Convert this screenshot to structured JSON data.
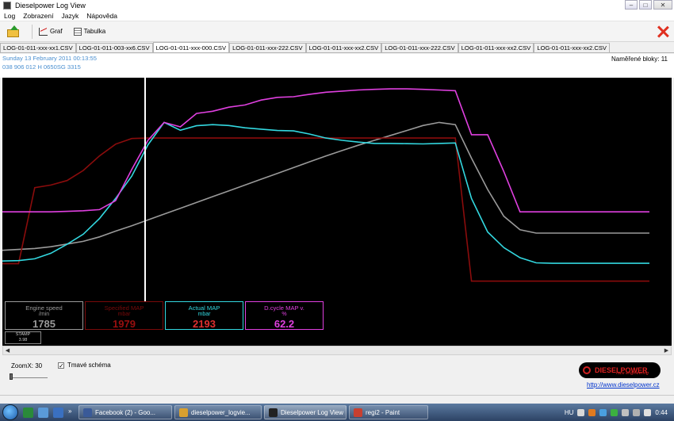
{
  "window": {
    "title": "Dieselpower Log View",
    "buttons": [
      "–",
      "□",
      "✕"
    ]
  },
  "menu": [
    "Log",
    "Zobrazení",
    "Jazyk",
    "Nápověda"
  ],
  "toolbar": {
    "graph_label": "Graf",
    "table_label": "Tabulka"
  },
  "tabs": [
    {
      "label": "LOG-01-011-xxx-xx1.CSV",
      "active": false
    },
    {
      "label": "LOG-01-011-003-xx6.CSV",
      "active": false
    },
    {
      "label": "LOG-01-011-xxx-000.CSV",
      "active": true
    },
    {
      "label": "LOG-01-011-xxx-222.CSV",
      "active": false
    },
    {
      "label": "LOG-01-011-xxx-xx2.CSV",
      "active": false
    },
    {
      "label": "LOG-01-011-xxx-222.CSV",
      "active": false
    },
    {
      "label": "LOG-01-011-xxx-xx2.CSV",
      "active": false
    },
    {
      "label": "LOG-01-011-xxx-xx2.CSV",
      "active": false
    }
  ],
  "info": {
    "date": "Sunday 13 February 2011 00:13:55",
    "ecu": "038 906 012 H  0650SG  3315",
    "blocks": "Naměřené bloky: 11"
  },
  "value_boxes": [
    {
      "name": "Engine speed",
      "unit": "/min",
      "value": "1785",
      "color": "#9a9a9a",
      "value_color": "#9a9a9a"
    },
    {
      "name": "Specified MAP",
      "unit": "mbar",
      "value": "1979",
      "color": "#7a0a0a",
      "value_color": "#9a0f0f"
    },
    {
      "name": "Actual MAP",
      "unit": "mbar",
      "value": "2193",
      "color": "#33d8e0",
      "value_color": "#e03030"
    },
    {
      "name": "D.cycle MAP v.",
      "unit": "%",
      "value": "62.2",
      "color": "#e040e0",
      "value_color": "#e040e0"
    }
  ],
  "stamp": {
    "label": "STAMP",
    "value": "3.98"
  },
  "chart_data": {
    "type": "line",
    "x": [
      0,
      1,
      2,
      3,
      4,
      5,
      6,
      7,
      8,
      9,
      10,
      11,
      12,
      13,
      14,
      15,
      16,
      17,
      18,
      19,
      20,
      21,
      22,
      23,
      24,
      25,
      26,
      27,
      28,
      29,
      30,
      31,
      32,
      33,
      34,
      35,
      36,
      37,
      38,
      39,
      40
    ],
    "series": [
      {
        "name": "Engine speed",
        "color": "#9a9a9a",
        "values": [
          228,
          232,
          236,
          244,
          256,
          268,
          288,
          314,
          338,
          364,
          390,
          416,
          442,
          468,
          494,
          520,
          546,
          572,
          598,
          624,
          650,
          674,
          698,
          720,
          742,
          764,
          786,
          800,
          790,
          640,
          500,
          380,
          320,
          305,
          305,
          305,
          305,
          305,
          305,
          305,
          305
        ]
      },
      {
        "name": "Specified MAP",
        "color": "#8a0c0c",
        "values": [
          168,
          168,
          508,
          520,
          540,
          585,
          650,
          703,
          728,
          730,
          730,
          730,
          730,
          730,
          730,
          730,
          730,
          730,
          730,
          730,
          730,
          730,
          730,
          730,
          730,
          730,
          730,
          730,
          730,
          90,
          90,
          90,
          90,
          90,
          90,
          90,
          90,
          90,
          90,
          90,
          90
        ]
      },
      {
        "name": "Actual MAP",
        "color": "#33d8e0",
        "values": [
          180,
          182,
          190,
          215,
          255,
          300,
          370,
          460,
          560,
          700,
          800,
          765,
          785,
          790,
          786,
          776,
          770,
          764,
          762,
          748,
          730,
          720,
          712,
          706,
          706,
          705,
          704,
          706,
          708,
          460,
          310,
          240,
          195,
          172,
          170,
          170,
          170,
          170,
          170,
          170,
          170
        ]
      },
      {
        "name": "D.cycle MAP v.",
        "color": "#e040e0",
        "values": [
          400,
          400,
          400,
          400,
          402,
          405,
          410,
          450,
          590,
          720,
          800,
          780,
          840,
          850,
          868,
          878,
          900,
          912,
          915,
          926,
          935,
          940,
          945,
          948,
          950,
          950,
          948,
          945,
          942,
          745,
          745,
          580,
          400,
          400,
          400,
          400,
          400,
          400,
          400,
          400,
          400
        ]
      }
    ],
    "cursor_index": 9
  },
  "bottom": {
    "zoom_label": "ZoomX: 30",
    "dark_scheme_label": "Tmavé schéma",
    "dark_scheme_checked": true,
    "logo_brand": "DIESELPOWER",
    "logo_sub": "race engineering",
    "link": "http://www.dieselpower.cz"
  },
  "taskbar": {
    "tasks": [
      {
        "label": "Facebook (2) - Goo...",
        "icon_color": "#3a5a98",
        "active": false
      },
      {
        "label": "dieselpower_logvie...",
        "icon_color": "#d8a030",
        "active": false
      },
      {
        "label": "Dieselpower Log View",
        "icon_color": "#222",
        "active": true
      },
      {
        "label": "regi2 - Paint",
        "icon_color": "#c84030",
        "active": false
      }
    ],
    "lang": "HU",
    "time": "0:44"
  }
}
